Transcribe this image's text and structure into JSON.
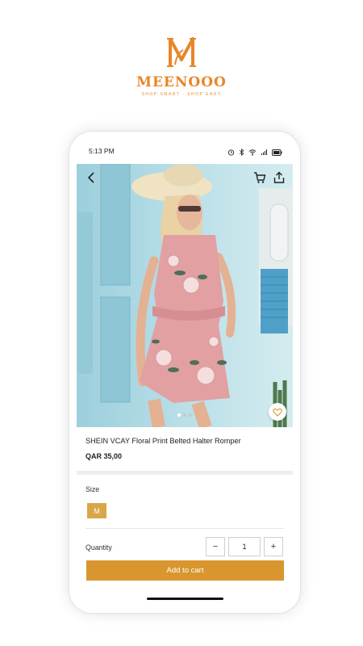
{
  "brand": {
    "name": "MEENOOO",
    "tagline": "SHOP SMART · SHOP EASY",
    "color": "#e8862a"
  },
  "status_bar": {
    "time": "5:13 PM",
    "icons": [
      "alarm-icon",
      "bluetooth-icon",
      "wifi-icon",
      "signal-icon",
      "battery-icon"
    ]
  },
  "product": {
    "title": "SHEIN VCAY Floral Print Belted Halter Romper",
    "price": "QAR 35,00",
    "image_dots": 3,
    "active_dot": 1
  },
  "size": {
    "label": "Size",
    "selected": "M"
  },
  "quantity": {
    "label": "Quantity",
    "decrement": "−",
    "value": "1",
    "increment": "+"
  },
  "actions": {
    "add_to_cart": "Add to cart",
    "accent_color": "#d9962e"
  }
}
